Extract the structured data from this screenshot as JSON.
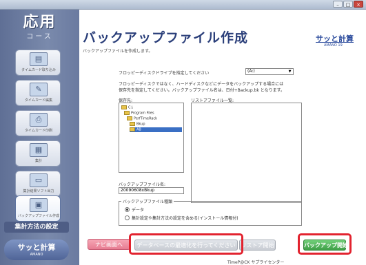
{
  "window": {
    "title": "",
    "controls": {
      "minimize": "–",
      "maximize": "□",
      "close": "×"
    }
  },
  "sidebar": {
    "course_title": "応用",
    "course_subtitle": "コース",
    "items": [
      {
        "label": "タイムカード取り込み"
      },
      {
        "label": "タイムカード編集"
      },
      {
        "label": "タイムカード印刷"
      },
      {
        "label": "集計"
      },
      {
        "label": "集計結果ソフト出力"
      },
      {
        "label": "バックアップファイル作成"
      }
    ],
    "calc_settings": "集計方法の設定",
    "logo_line1": "サッと計算",
    "logo_line2": "AMANO"
  },
  "main": {
    "title": "バックアップファイル作成",
    "subtitle": "バックアップファイルを作成します。",
    "brand": "サッと計算",
    "brand_sub": "AMANO 19",
    "drive_label": "フロッピーディスクドライブを指定してください",
    "drive_value": "(A:)",
    "info_text_1": "フロッピーディスクではなく、ハードディスクなどにデータをバックアップする場合には",
    "info_text_2": "保存先を指定してください。バックアップファイル名は、日付+Backup.bk となります。",
    "save_to_label": "保存先:",
    "list_label": "リストアファイル一覧:",
    "tree_items": [
      "C:\\",
      "Program Files",
      "PerfTimeRack",
      "Bkup",
      "AB"
    ],
    "filename_label": "バックアップファイル名:",
    "filename_value": "20090608xBkup",
    "type_group_label": "バックアップファイル種類",
    "options": [
      {
        "label": "データ",
        "selected": true
      },
      {
        "label": "集計設定や集計方法の設定を含める(インストール情報付)",
        "selected": false
      }
    ]
  },
  "footer": {
    "navi_button": "ナビ画面へ",
    "sync_button": "データベースの最適化を行ってください",
    "restore_button": "リストア開始",
    "backup_button": "バックアップ開始",
    "credit": "TimeP@CK サプライセンター"
  },
  "colors": {
    "highlight": "#e2232f",
    "accent": "#2b3f7a",
    "exec_green": "#3e9f47"
  }
}
